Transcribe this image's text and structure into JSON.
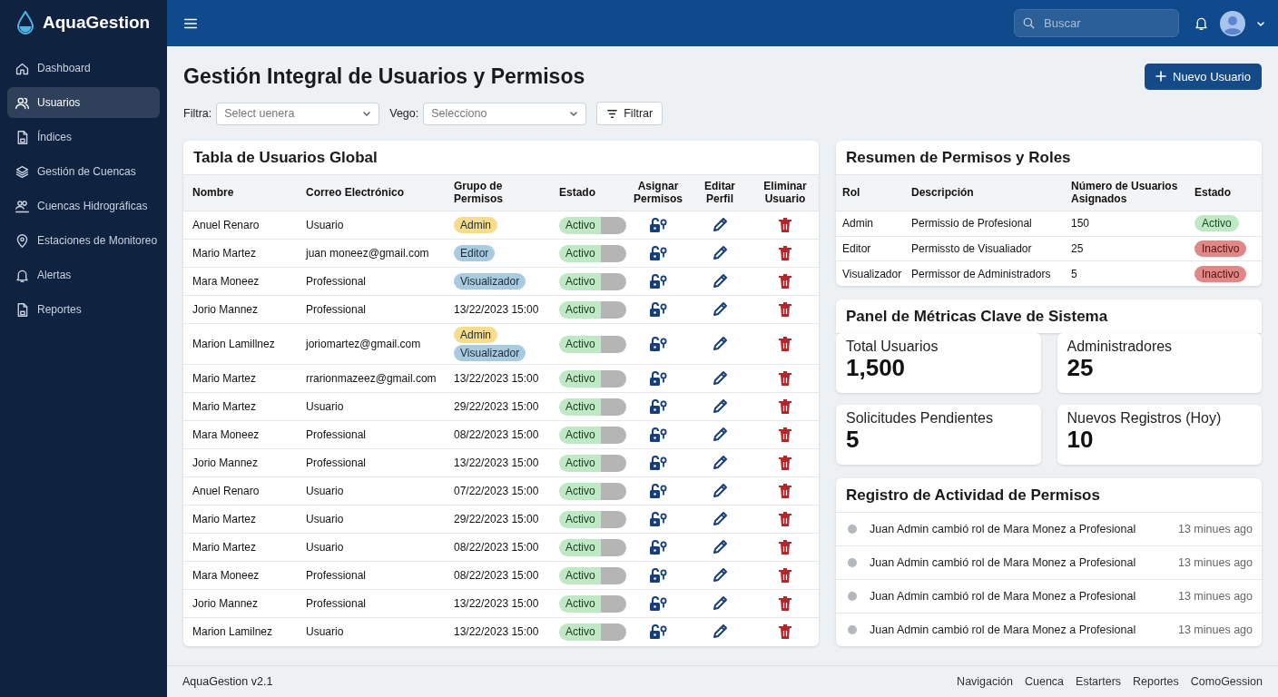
{
  "app": {
    "name": "AquaGestion"
  },
  "sidebar": {
    "items": [
      {
        "label": "Dashboard",
        "kind": "home",
        "selected": false
      },
      {
        "label": "Usuarios",
        "kind": "users",
        "selected": true
      },
      {
        "label": "Índices",
        "kind": "doc",
        "selected": false
      },
      {
        "label": "Gestión de Cuencas",
        "kind": "layers",
        "selected": false
      },
      {
        "label": "Cuencas Hidrográficas",
        "kind": "group",
        "selected": false
      },
      {
        "label": "Estaciones de Monitoreo",
        "kind": "pin",
        "selected": false
      },
      {
        "label": "Alertas",
        "kind": "bell",
        "selected": false
      },
      {
        "label": "Reportes",
        "kind": "doc",
        "selected": false
      }
    ]
  },
  "topbar": {
    "search": {
      "placeholder": "Buscar"
    }
  },
  "page": {
    "title": "Gestión Integral de Usuarios y Permisos",
    "new_button": "Nuevo Usuario"
  },
  "filters": {
    "filter_label": "Filtra:",
    "filter_select": {
      "placeholder": "Select uenera"
    },
    "vego_label": "Vego:",
    "vego_select": {
      "placeholder": "Selecciono"
    },
    "filter_button": "Filtrar"
  },
  "users_table": {
    "title": "Tabla de Usuarios Global",
    "columns": [
      "Nombre",
      "Correo Electrónico",
      "Grupo de Permisos",
      "Estado",
      "Asignar Permisos",
      "Editar Perfil",
      "Eliminar Usuario"
    ],
    "rows": [
      {
        "name": "Anuel Renaro",
        "email": "Usuario",
        "group": {
          "kind": "badges",
          "badges": [
            {
              "label": "Admin",
              "color": "#f6dc8c"
            }
          ]
        },
        "status": {
          "label": "Activo",
          "on": true
        }
      },
      {
        "name": "Mario Martez",
        "email": "juan moneez@gmail.com",
        "group": {
          "kind": "badges",
          "badges": [
            {
              "label": "Editor",
              "color": "#a9cbe0"
            }
          ]
        },
        "status": {
          "label": "Activo",
          "on": true
        }
      },
      {
        "name": "Mara Moneez",
        "email": "Professional",
        "group": {
          "kind": "badges",
          "badges": [
            {
              "label": "Visualizador",
              "color": "#a9cbe0"
            }
          ]
        },
        "status": {
          "label": "Activo",
          "on": true
        }
      },
      {
        "name": "Jorio Mannez",
        "email": "Professional",
        "group": {
          "kind": "text",
          "text": "13/22/2023 15:00"
        },
        "status": {
          "label": "Activo",
          "on": true
        }
      },
      {
        "name": "Marion Lamillnez",
        "email": "joriomartez@gmail.com",
        "group": {
          "kind": "badges",
          "badges": [
            {
              "label": "Admin",
              "color": "#f6dc8c"
            },
            {
              "label": "Visualizador",
              "color": "#a9cbe0"
            }
          ]
        },
        "status": {
          "label": "Activo",
          "on": true
        }
      },
      {
        "name": "Mario Martez",
        "email": "rrarionmazeez@gmail.com",
        "group": {
          "kind": "text",
          "text": "13/22/2023 15:00"
        },
        "status": {
          "label": "Activo",
          "on": true
        }
      },
      {
        "name": "Mario Martez",
        "email": "Usuario",
        "group": {
          "kind": "text",
          "text": "29/22/2023 15:00"
        },
        "status": {
          "label": "Activo",
          "on": true
        }
      },
      {
        "name": "Mara Moneez",
        "email": "Professional",
        "group": {
          "kind": "text",
          "text": "08/22/2023 15:00"
        },
        "status": {
          "label": "Activo",
          "on": true
        }
      },
      {
        "name": "Jorio Mannez",
        "email": "Professional",
        "group": {
          "kind": "text",
          "text": "13/22/2023 15:00"
        },
        "status": {
          "label": "Activo",
          "on": true
        }
      },
      {
        "name": "Anuel Renaro",
        "email": "Usuario",
        "group": {
          "kind": "text",
          "text": "07/22/2023 15:00"
        },
        "status": {
          "label": "Activo",
          "on": true
        }
      },
      {
        "name": "Mario Martez",
        "email": "Usuario",
        "group": {
          "kind": "text",
          "text": "29/22/2023 15:00"
        },
        "status": {
          "label": "Activo",
          "on": true
        }
      },
      {
        "name": "Mario Martez",
        "email": "Usuario",
        "group": {
          "kind": "text",
          "text": "08/22/2023 15:00"
        },
        "status": {
          "label": "Activo",
          "on": true
        }
      },
      {
        "name": "Mara Moneez",
        "email": "Professional",
        "group": {
          "kind": "text",
          "text": "08/22/2023 15:00"
        },
        "status": {
          "label": "Activo",
          "on": true
        }
      },
      {
        "name": "Jorio Mannez",
        "email": "Professional",
        "group": {
          "kind": "text",
          "text": "13/22/2023 15:00"
        },
        "status": {
          "label": "Activo",
          "on": true
        }
      },
      {
        "name": "Marion Lamilnez",
        "email": "Usuario",
        "group": {
          "kind": "text",
          "text": "13/22/2023 15:00"
        },
        "status": {
          "label": "Activo",
          "on": true
        }
      }
    ]
  },
  "roles_table": {
    "title": "Resumen de Permisos y Roles",
    "columns": [
      "Rol",
      "Descripción",
      "Número de Usuarios Asignados",
      "Estado"
    ],
    "rows": [
      {
        "role": "Admin",
        "description": "Permissio de Profesional",
        "count": "150",
        "status": {
          "label": "Activo",
          "active": true
        }
      },
      {
        "role": "Editor",
        "description": "Permissto de Visualiador",
        "count": "25",
        "status": {
          "label": "Inactivo",
          "active": false
        }
      },
      {
        "role": "Visualizador",
        "description": "Permissor de Administradors",
        "count": "5",
        "status": {
          "label": "Inactivo",
          "active": false
        }
      }
    ]
  },
  "metrics": {
    "title": "Panel de Métricas Clave de Sistema",
    "cards": [
      {
        "label": "Total Usuarios",
        "value": "1,500"
      },
      {
        "label": "Administradores",
        "value": "25"
      },
      {
        "label": "Solicitudes Pendientes",
        "value": "5"
      },
      {
        "label": "Nuevos Registros (Hoy)",
        "value": "10"
      }
    ]
  },
  "activity": {
    "title": "Registro de Actividad de Permisos",
    "items": [
      {
        "text": "Juan Admin cambió rol de Mara Monez a Profesional",
        "time": "13 minues ago"
      },
      {
        "text": "Juan Admin cambió rol de Mara Monez a Profesional",
        "time": "13 minues ago"
      },
      {
        "text": "Juan Admin cambió rol de Mara Monez a Profesional",
        "time": "13 minues ago"
      },
      {
        "text": "Juan Admin cambió rol de Mara Monez a Profesional",
        "time": "13 minues ago"
      }
    ]
  },
  "footer": {
    "version": "AquaGestion v2.1",
    "links": [
      "Navigación",
      "Cuenca",
      "Estarters",
      "Reportes",
      "ComoGession"
    ]
  }
}
